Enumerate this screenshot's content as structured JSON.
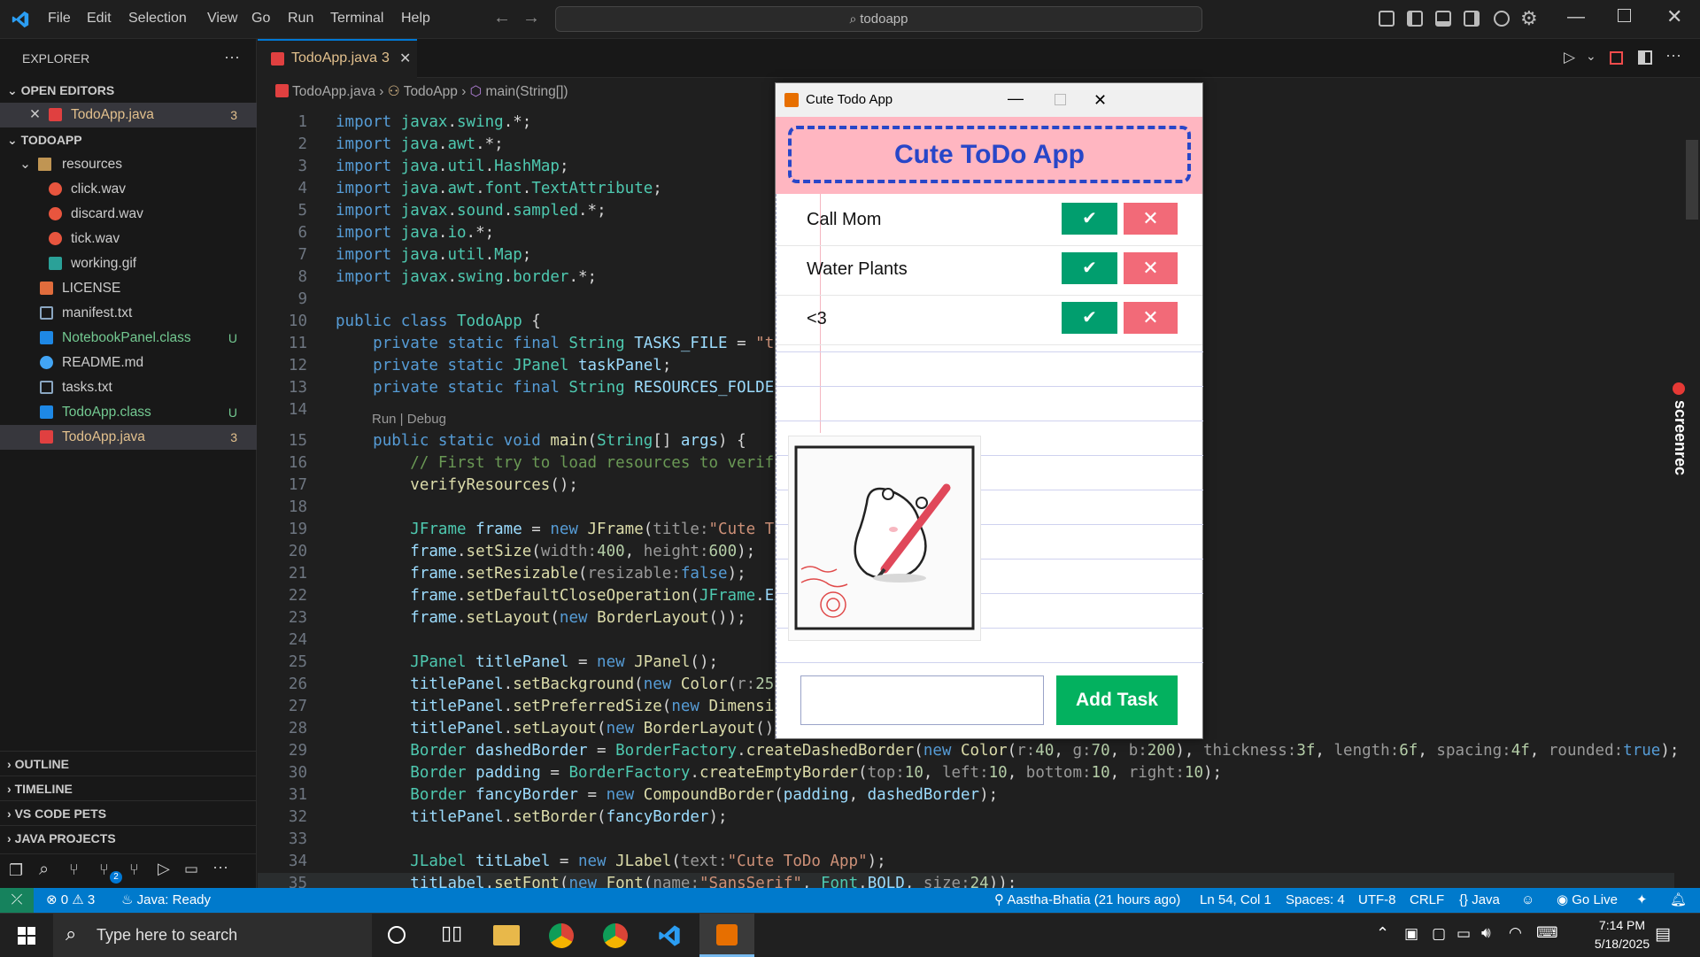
{
  "menubar": {
    "items": [
      "File",
      "Edit",
      "Selection",
      "View",
      "Go",
      "Run",
      "Terminal",
      "Help"
    ],
    "search": "todoapp"
  },
  "sidebar": {
    "title": "EXPLORER",
    "open_editors": "OPEN EDITORS",
    "open_file": {
      "name": "TodoApp.java",
      "badge": "3"
    },
    "project": "TODOAPP",
    "folder": "resources",
    "resources": [
      "click.wav",
      "discard.wav",
      "tick.wav",
      "working.gif"
    ],
    "files": [
      {
        "name": "LICENSE",
        "badge": ""
      },
      {
        "name": "manifest.txt",
        "badge": ""
      },
      {
        "name": "NotebookPanel.class",
        "badge": "U"
      },
      {
        "name": "README.md",
        "badge": ""
      },
      {
        "name": "tasks.txt",
        "badge": ""
      },
      {
        "name": "TodoApp.class",
        "badge": "U"
      },
      {
        "name": "TodoApp.java",
        "badge": "3"
      }
    ],
    "sections": [
      "OUTLINE",
      "TIMELINE",
      "VS CODE PETS",
      "JAVA PROJECTS"
    ],
    "scm_badge": "2"
  },
  "editor": {
    "tab": {
      "name": "TodoApp.java",
      "badge": "3"
    },
    "breadcrumb": [
      "TodoApp.java",
      "TodoApp",
      "main(String[])"
    ],
    "codelens": "Run | Debug"
  },
  "swing_app": {
    "window_title": "Cute Todo App",
    "heading": "Cute ToDo App",
    "tasks": [
      {
        "label": "Call Mom"
      },
      {
        "label": "Water Plants"
      },
      {
        "label": "<3"
      }
    ],
    "done_glyph": "✔",
    "delete_glyph": "✕",
    "input_value": "",
    "add_button": "Add Task"
  },
  "statusbar": {
    "errors": "0",
    "warnings": "3",
    "java": "Java: Ready",
    "blame": "Aastha-Bhatia (21 hours ago)",
    "position": "Ln 54, Col 1",
    "spaces": "Spaces: 4",
    "encoding": "UTF-8",
    "eol": "CRLF",
    "language": "Java",
    "golive": "Go Live"
  },
  "taskbar": {
    "search_placeholder": "Type here to search",
    "time": "7:14 PM",
    "date": "5/18/2025"
  },
  "side_label": "screenrec",
  "colors": {
    "accent": "#007acc",
    "pink_header": "#ffb6c1",
    "done_green": "#019e6e",
    "delete_red": "#f26a78",
    "add_green": "#03b15f"
  }
}
